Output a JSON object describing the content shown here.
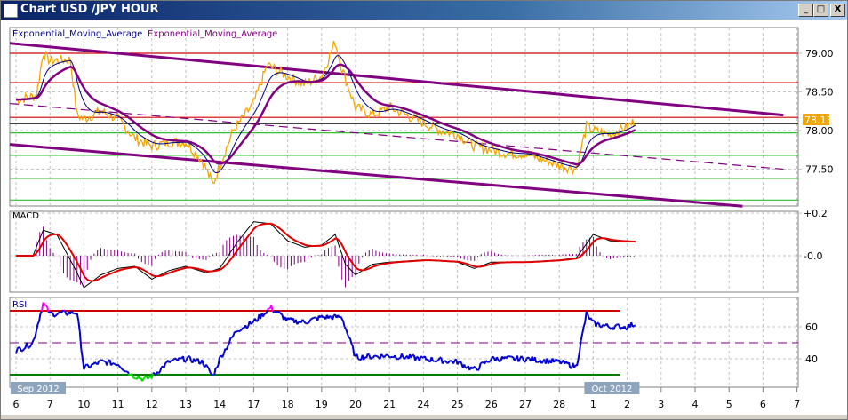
{
  "window": {
    "title": "Chart USD /JPY  HOUR",
    "minimize": "_",
    "maximize": "□",
    "close": "X"
  },
  "legend": {
    "ema_fast": "Exponential_Moving_Average",
    "ema_slow": "Exponential_Moving_Average"
  },
  "colors": {
    "price": "#f0a500",
    "ema_fast": "#000080",
    "ema_slow": "#800080",
    "macd": "#000000",
    "signal": "#e00000",
    "hist": "#800080",
    "rsi": "#0000d0",
    "rsi_high": "#ff00ff",
    "rsi_low": "#00e000",
    "badge": "#8ea4bc",
    "last_price_bg": "#f0a500"
  },
  "chart_data": [
    {
      "type": "line",
      "title": "USD/JPY HOUR",
      "ylim": [
        77.05,
        79.35
      ],
      "y_ticks": [
        "79.00",
        "78.50",
        "78.00",
        "77.50"
      ],
      "y_tick_values": [
        79.0,
        78.5,
        78.0,
        77.5
      ],
      "last_price": "78.13",
      "x_tick_labels": [
        "6",
        "7",
        "10",
        "11",
        "12",
        "13",
        "14",
        "17",
        "18",
        "19",
        "20",
        "21",
        "24",
        "25",
        "26",
        "27",
        "28",
        "1",
        "2",
        "3",
        "4",
        "5",
        "6",
        "7"
      ],
      "month_labels": [
        {
          "label": "Sep 2012",
          "index": 0
        },
        {
          "label": "Oct 2012",
          "index": 17
        }
      ],
      "price": [
        [
          0,
          78.4
        ],
        [
          0.6,
          78.45
        ],
        [
          0.8,
          79.0
        ],
        [
          1,
          78.9
        ],
        [
          1.6,
          78.92
        ],
        [
          1.8,
          78.2
        ],
        [
          2,
          78.15
        ],
        [
          2.5,
          78.25
        ],
        [
          3,
          78.15
        ],
        [
          3.5,
          77.9
        ],
        [
          4,
          77.8
        ],
        [
          4.5,
          77.85
        ],
        [
          5,
          77.85
        ],
        [
          5.5,
          77.6
        ],
        [
          5.8,
          77.3
        ],
        [
          6,
          77.55
        ],
        [
          6.4,
          78.0
        ],
        [
          7,
          78.35
        ],
        [
          7.4,
          78.85
        ],
        [
          8,
          78.7
        ],
        [
          8.5,
          78.6
        ],
        [
          9,
          78.7
        ],
        [
          9.4,
          79.15
        ],
        [
          9.6,
          78.8
        ],
        [
          10,
          78.3
        ],
        [
          10.5,
          78.2
        ],
        [
          11,
          78.3
        ],
        [
          12,
          78.1
        ],
        [
          12.5,
          78.0
        ],
        [
          13,
          77.95
        ],
        [
          13.5,
          77.8
        ],
        [
          14,
          77.75
        ],
        [
          14.5,
          77.7
        ],
        [
          15,
          77.7
        ],
        [
          16,
          77.55
        ],
        [
          16.5,
          77.5
        ],
        [
          16.8,
          78.05
        ],
        [
          17,
          78.0
        ],
        [
          17.5,
          77.95
        ],
        [
          18,
          78.05
        ],
        [
          18.25,
          78.13
        ]
      ],
      "horizontal_levels": [
        {
          "value": 79.0,
          "color": "#d00000"
        },
        {
          "value": 78.62,
          "color": "#d00000"
        },
        {
          "value": 78.17,
          "color": "#d00000"
        },
        {
          "value": 78.09,
          "color": "#000000"
        },
        {
          "value": 77.97,
          "color": "#30c030"
        },
        {
          "value": 77.68,
          "color": "#30c030"
        },
        {
          "value": 77.38,
          "color": "#30c030"
        },
        {
          "value": 77.1,
          "color": "#30c030"
        }
      ],
      "trendlines": [
        {
          "style": "solid",
          "from": [
            -0.2,
            79.13
          ],
          "to": [
            22.6,
            78.2
          ]
        },
        {
          "style": "solid",
          "from": [
            -0.2,
            77.82
          ],
          "to": [
            21.4,
            77.02
          ]
        },
        {
          "style": "dashed",
          "from": [
            -0.2,
            78.35
          ],
          "to": [
            22.6,
            77.5
          ]
        }
      ]
    },
    {
      "type": "line",
      "title": "MACD",
      "ylim": [
        -0.19,
        0.2
      ],
      "y_ticks": [
        "+0.2",
        "-0.0"
      ],
      "y_tick_values": [
        0.2,
        0.0
      ],
      "macd": [
        [
          0,
          0
        ],
        [
          0.5,
          0.0
        ],
        [
          0.8,
          0.12
        ],
        [
          1.2,
          0.1
        ],
        [
          1.8,
          -0.08
        ],
        [
          2,
          -0.15
        ],
        [
          2.5,
          -0.09
        ],
        [
          3,
          -0.06
        ],
        [
          3.5,
          -0.05
        ],
        [
          4,
          -0.11
        ],
        [
          4.5,
          -0.07
        ],
        [
          5,
          -0.05
        ],
        [
          5.6,
          -0.08
        ],
        [
          6,
          -0.06
        ],
        [
          6.5,
          0.06
        ],
        [
          7,
          0.16
        ],
        [
          7.5,
          0.15
        ],
        [
          8,
          0.07
        ],
        [
          8.5,
          0.04
        ],
        [
          9,
          0.05
        ],
        [
          9.4,
          0.1
        ],
        [
          9.7,
          -0.04
        ],
        [
          10,
          -0.09
        ],
        [
          10.5,
          -0.04
        ],
        [
          11,
          -0.03
        ],
        [
          12,
          -0.02
        ],
        [
          13,
          -0.03
        ],
        [
          13.5,
          -0.06
        ],
        [
          14,
          -0.03
        ],
        [
          15,
          -0.03
        ],
        [
          16,
          -0.02
        ],
        [
          16.5,
          -0.01
        ],
        [
          17,
          0.1
        ],
        [
          17.5,
          0.07
        ],
        [
          18.25,
          0.065
        ]
      ]
    },
    {
      "type": "line",
      "title": "RSI",
      "ylim": [
        20,
        80
      ],
      "y_ticks": [
        "60",
        "40"
      ],
      "y_tick_values": [
        60,
        40
      ],
      "levels": [
        70,
        50,
        30
      ],
      "rsi": [
        [
          0,
          45
        ],
        [
          0.5,
          50
        ],
        [
          0.8,
          75
        ],
        [
          1,
          68
        ],
        [
          1.8,
          69
        ],
        [
          2,
          34
        ],
        [
          2.5,
          38
        ],
        [
          3,
          37
        ],
        [
          3.4,
          30
        ],
        [
          3.8,
          27
        ],
        [
          4,
          29
        ],
        [
          4.5,
          38
        ],
        [
          5,
          40
        ],
        [
          5.5,
          38
        ],
        [
          5.8,
          29
        ],
        [
          6,
          40
        ],
        [
          6.5,
          58
        ],
        [
          7,
          63
        ],
        [
          7.5,
          72
        ],
        [
          8,
          64
        ],
        [
          8.5,
          63
        ],
        [
          9,
          66
        ],
        [
          9.6,
          66
        ],
        [
          10,
          41
        ],
        [
          11,
          42
        ],
        [
          12,
          40
        ],
        [
          13,
          38
        ],
        [
          13.5,
          33
        ],
        [
          14,
          40
        ],
        [
          15,
          40
        ],
        [
          16,
          38
        ],
        [
          16.5,
          35
        ],
        [
          16.8,
          68
        ],
        [
          17,
          62
        ],
        [
          17.5,
          60
        ],
        [
          18,
          60
        ],
        [
          18.25,
          62
        ]
      ]
    }
  ]
}
